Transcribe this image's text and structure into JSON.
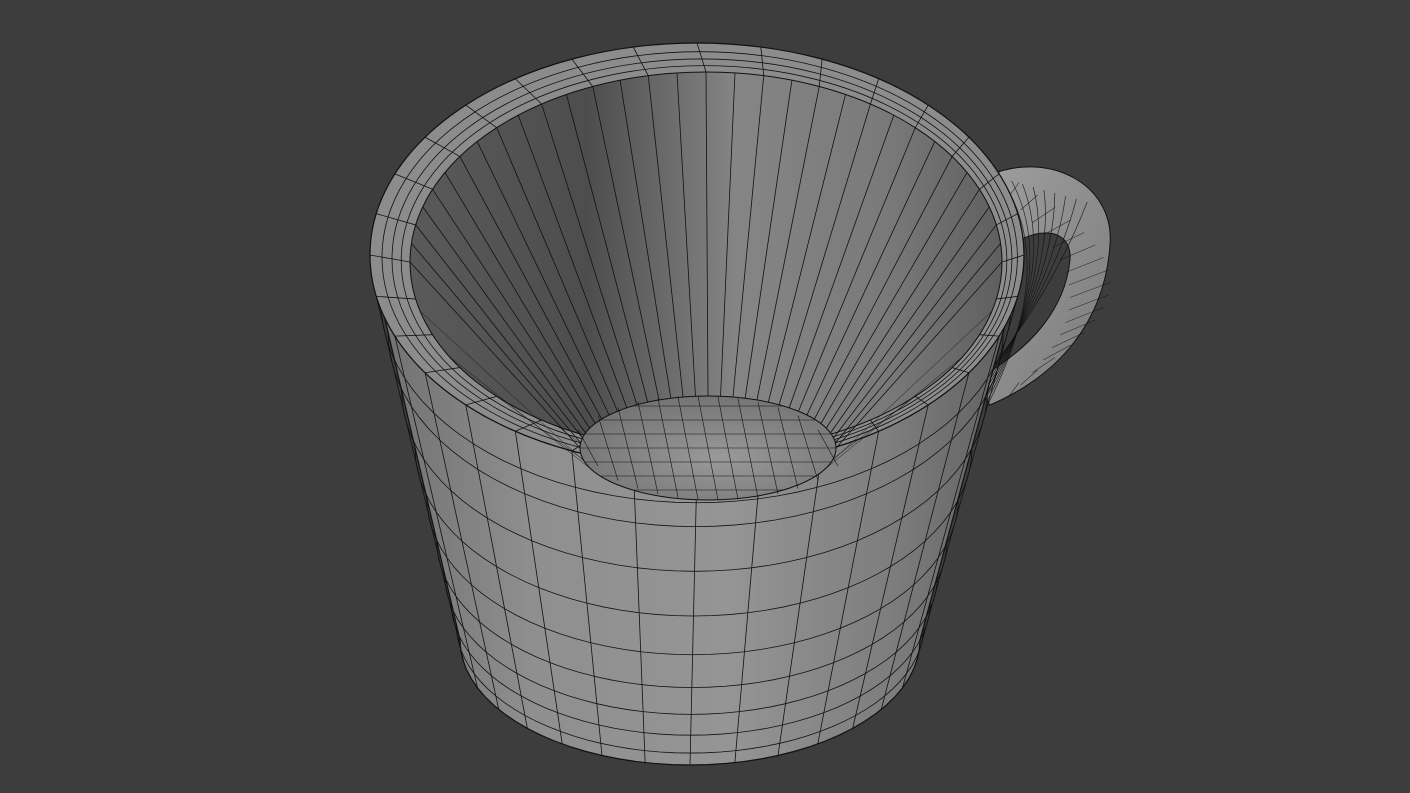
{
  "viewport": {
    "background_color": "#3d3d3d",
    "shading": "solid",
    "wireframe_overlay": true
  },
  "mesh": {
    "object": "mug",
    "parts": [
      "body",
      "rim",
      "interior",
      "inner-bottom",
      "handle"
    ],
    "body_color": "#8a8a8a",
    "wire_color": "#111111"
  }
}
